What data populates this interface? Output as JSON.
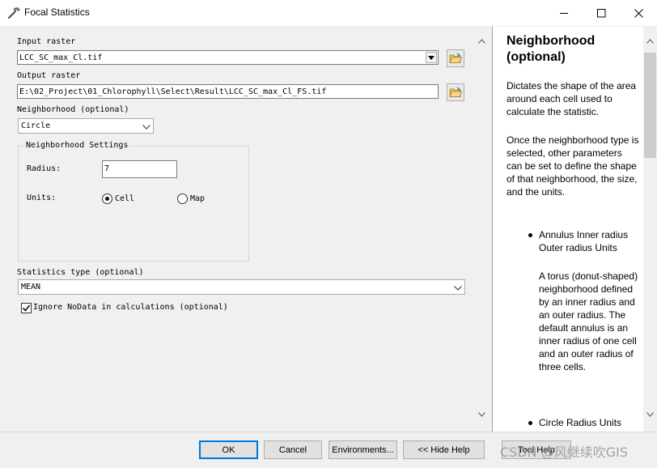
{
  "window": {
    "title": "Focal Statistics",
    "icon": "hammer-icon"
  },
  "params": {
    "input_raster": {
      "label": "Input raster",
      "value": "LCC_SC_max_Cl.tif"
    },
    "output_raster": {
      "label": "Output raster",
      "value": "E:\\02_Project\\01_Chlorophyll\\Select\\Result\\LCC_SC_max_Cl_FS.tif"
    },
    "neighborhood": {
      "label": "Neighborhood (optional)",
      "value": "Circle"
    },
    "neighborhood_settings": {
      "title": "Neighborhood Settings",
      "radius_label": "Radius:",
      "radius_value": "7",
      "units_label": "Units:",
      "unit_cell": "Cell",
      "unit_map": "Map",
      "selected_unit": "Cell"
    },
    "statistics_type": {
      "label": "Statistics type (optional)",
      "value": "MEAN"
    },
    "ignore_nodata": {
      "label": "Ignore NoData in calculations (optional)",
      "checked": true
    }
  },
  "help": {
    "title_line1": "Neighborhood",
    "title_line2": "(optional)",
    "para1": "Dictates the shape of the area around each cell used to calculate the statistic.",
    "para2": "Once the neighborhood type is selected, other parameters can be set to define the shape of that neighborhood, the size, and the units.",
    "bullet1_title": "Annulus Inner radius Outer radius Units",
    "bullet1_desc": "A torus (donut-shaped) neighborhood defined by an inner radius and an outer radius. The default annulus is an inner radius of one cell and an outer radius of three cells.",
    "bullet2_title": "Circle Radius Units"
  },
  "buttons": {
    "ok": "OK",
    "cancel": "Cancel",
    "environments": "Environments...",
    "hide_help": "<< Hide Help",
    "tool_help": "Tool Help"
  },
  "watermark": "CSDN @风继续吹GIS"
}
